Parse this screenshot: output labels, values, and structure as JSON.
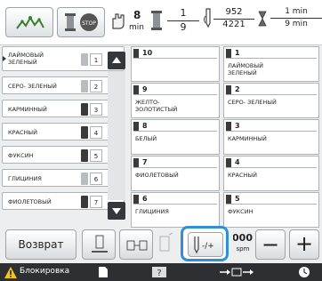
{
  "topbar": {
    "speed": {
      "value": "8",
      "unit": "min"
    },
    "stitch": {
      "top": "1",
      "bottom": "9"
    },
    "counter": {
      "top": "952",
      "bottom": "4221"
    },
    "time": {
      "top": "1 min",
      "bottom": "9 min"
    }
  },
  "color_list": [
    {
      "label": "ЛАЙМОВЫЙ\nЗЕЛЕНЫЙ",
      "index": "1",
      "selected": true,
      "spool": "light"
    },
    {
      "label": "СЕРО- ЗЕЛЕНЫЙ",
      "index": "2",
      "spool": "light"
    },
    {
      "label": "КАРМИННЫЙ",
      "index": "3",
      "spool": "dark"
    },
    {
      "label": "КРАСНЫЙ",
      "index": "4",
      "spool": "dark"
    },
    {
      "label": "ФУКСИН",
      "index": "5",
      "spool": "dark"
    },
    {
      "label": "ГЛИЦИНИЯ",
      "index": "6",
      "spool": "light"
    },
    {
      "label": "ФИОЛЕТОВЫЙ",
      "index": "7",
      "spool": "dark"
    }
  ],
  "grid": [
    {
      "n": "10",
      "name": ""
    },
    {
      "n": "1",
      "name": "ЛАЙМОВЫЙ\nЗЕЛЕНЫЙ"
    },
    {
      "n": "9",
      "name": "ЖЕЛТО-\nЗОЛОТИСТЫЙ"
    },
    {
      "n": "2",
      "name": "СЕРО- ЗЕЛЕНЫЙ"
    },
    {
      "n": "8",
      "name": "БЕЛЫЙ"
    },
    {
      "n": "3",
      "name": "КАРМИННЫЙ"
    },
    {
      "n": "7",
      "name": "ФИОЛЕТОВЫЙ"
    },
    {
      "n": "4",
      "name": "КРАСНЫЙ"
    },
    {
      "n": "6",
      "name": "ГЛИЦИНИЯ"
    },
    {
      "n": "5",
      "name": "ФУКСИН"
    }
  ],
  "bottom": {
    "back_label": "Возврат",
    "speed_value": "1000",
    "speed_unit": "spm",
    "minus": "−",
    "plus": "+"
  },
  "status": {
    "lock_label": "Блокировка"
  },
  "colors": {
    "highlight": "#2f8fd8",
    "dark": "#2d2f33"
  }
}
